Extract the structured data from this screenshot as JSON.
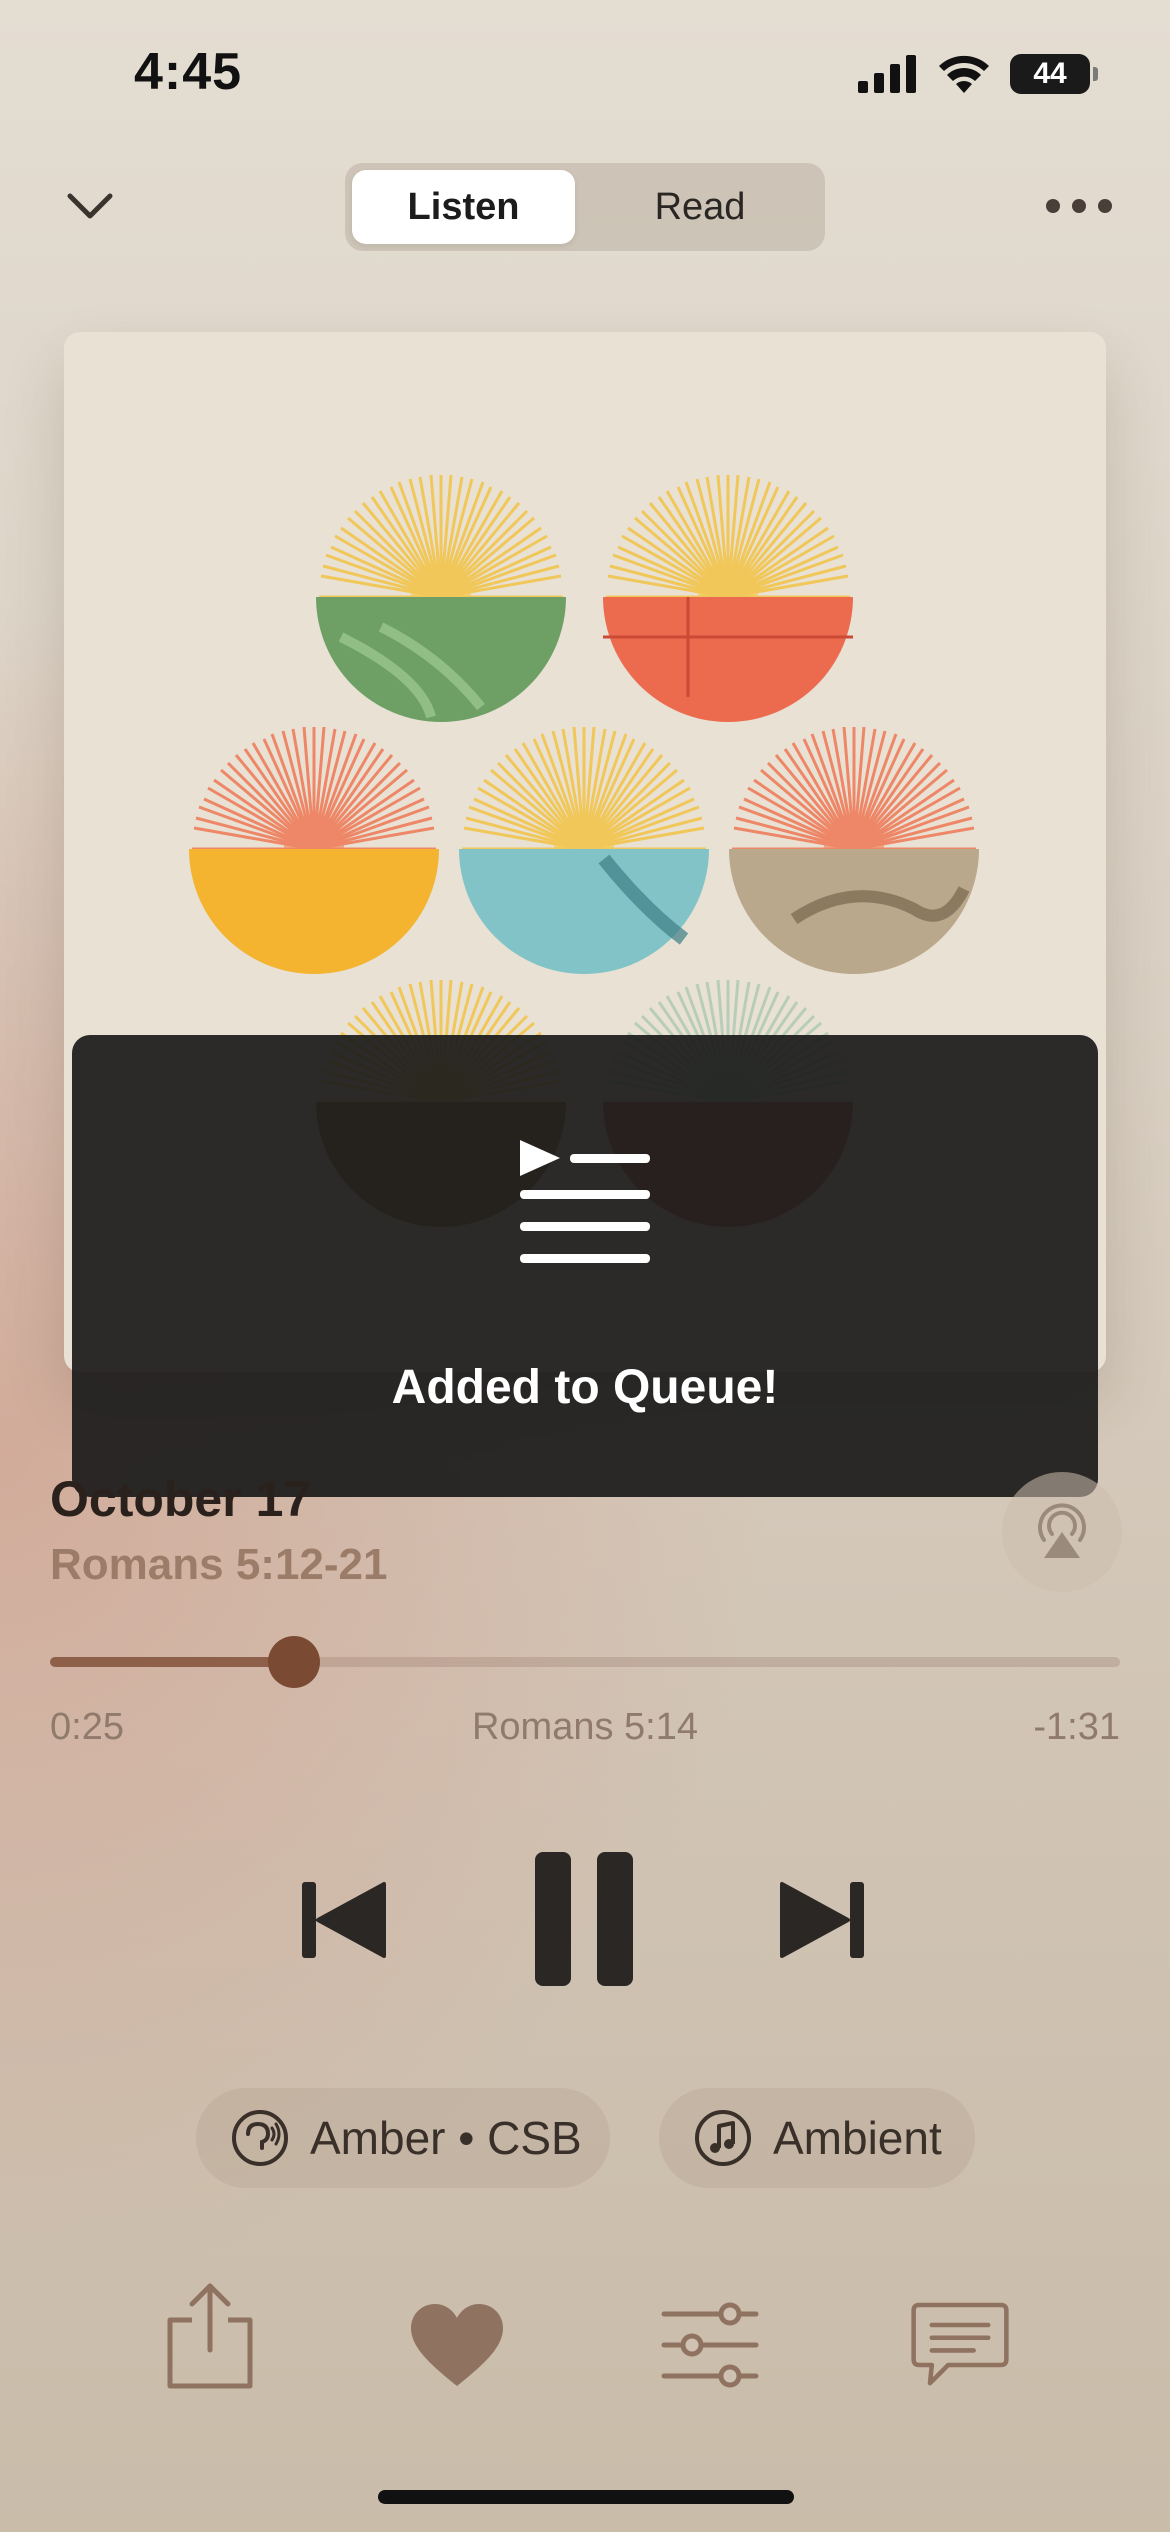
{
  "status_bar": {
    "time": "4:45",
    "battery": "44"
  },
  "header": {
    "tabs": [
      {
        "label": "Listen",
        "selected": true
      },
      {
        "label": "Read",
        "selected": false
      }
    ]
  },
  "toast": {
    "message": "Added to Queue!"
  },
  "track": {
    "title": "October 17",
    "passage": "Romans 5:12-21"
  },
  "progress": {
    "elapsed": "0:25",
    "chapter": "Romans 5:14",
    "remaining": "-1:31",
    "fraction": 0.22
  },
  "chips": {
    "voice": "Amber • CSB",
    "ambient": "Ambient"
  },
  "colors": {
    "accent": "#7b4a33",
    "toast_bg": "#1c1c1c"
  },
  "icons": [
    "chevron-down-icon",
    "more-icon",
    "queue-icon",
    "airplay-icon",
    "skip-back-icon",
    "pause-icon",
    "skip-forward-icon",
    "voice-icon",
    "music-note-icon",
    "share-icon",
    "heart-icon",
    "sliders-icon",
    "comment-icon"
  ]
}
